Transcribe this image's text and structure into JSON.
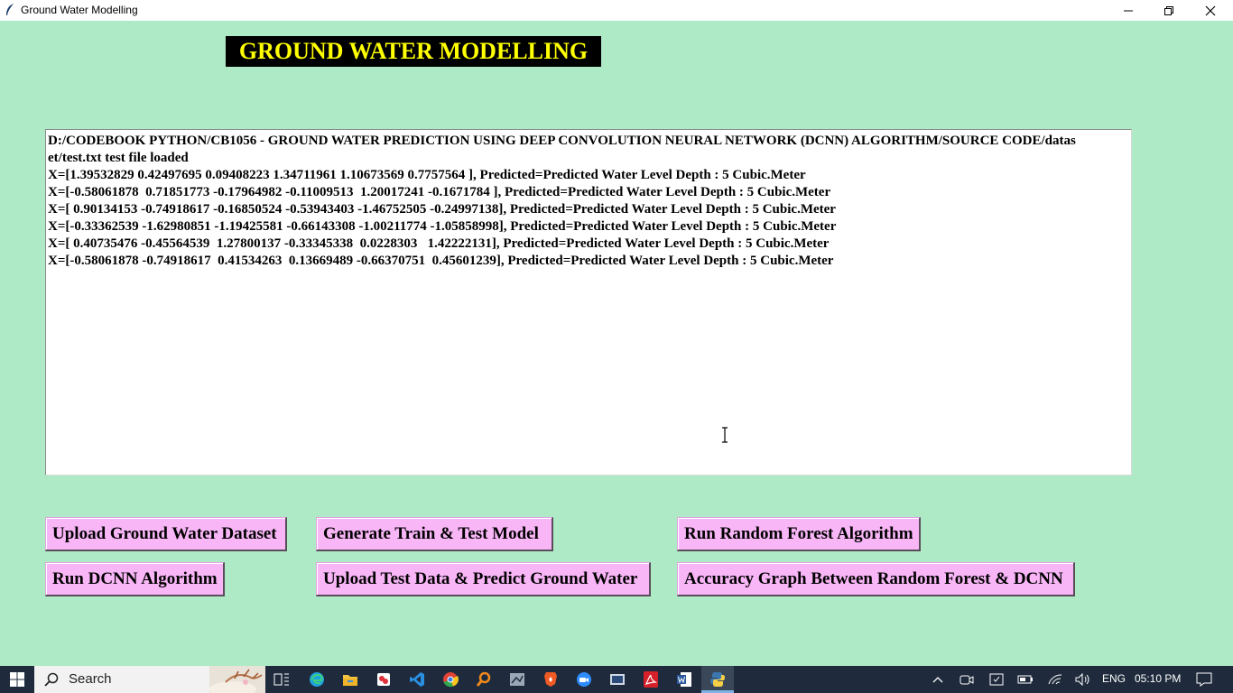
{
  "window": {
    "title": "Ground Water Modelling",
    "controls": [
      "minimize-icon",
      "restore-icon",
      "close-icon"
    ]
  },
  "heading": "GROUND WATER MODELLING",
  "output_lines": [
    "D:/CODEBOOK PYTHON/CB1056 - GROUND WATER PREDICTION USING DEEP CONVOLUTION NEURAL NETWORK (DCNN) ALGORITHM/SOURCE CODE/datas",
    "et/test.txt test file loaded",
    "X=[1.39532829 0.42497695 0.09408223 1.34711961 1.10673569 0.7757564 ], Predicted=Predicted Water Level Depth : 5 Cubic.Meter",
    "X=[-0.58061878  0.71851773 -0.17964982 -0.11009513  1.20017241 -0.1671784 ], Predicted=Predicted Water Level Depth : 5 Cubic.Meter",
    "X=[ 0.90134153 -0.74918617 -0.16850524 -0.53943403 -1.46752505 -0.24997138], Predicted=Predicted Water Level Depth : 5 Cubic.Meter",
    "X=[-0.33362539 -1.62980851 -1.19425581 -0.66143308 -1.00211774 -1.05858998], Predicted=Predicted Water Level Depth : 5 Cubic.Meter",
    "X=[ 0.40735476 -0.45564539  1.27800137 -0.33345338  0.0228303   1.42222131], Predicted=Predicted Water Level Depth : 5 Cubic.Meter",
    "X=[-0.58061878 -0.74918617  0.41534263  0.13669489 -0.66370751  0.45601239], Predicted=Predicted Water Level Depth : 5 Cubic.Meter"
  ],
  "buttons": {
    "upload_dataset": "Upload Ground Water Dataset",
    "generate_model": "Generate Train & Test Model",
    "run_random_forest": "Run Random Forest Algorithm",
    "run_dcnn": "Run DCNN Algorithm",
    "upload_test_predict": "Upload Test Data & Predict Ground Water",
    "accuracy_graph": "Accuracy Graph Between Random Forest & DCNN"
  },
  "taskbar": {
    "search_placeholder": "Search",
    "language": "ENG",
    "time": "05:10 PM",
    "pinned_apps": [
      "task-view-icon",
      "edge-icon",
      "file-explorer-icon",
      "app-icon",
      "vscode-icon",
      "chrome-icon",
      "search-app-icon",
      "app-icon",
      "brave-icon",
      "zoom-icon",
      "sc-app-icon",
      "acrobat-icon",
      "word-icon",
      "python-icon"
    ]
  },
  "colors": {
    "background": "#aeeac6",
    "heading_bg": "#000000",
    "heading_fg": "#ffff00",
    "button_bg": "#f9b6f7",
    "taskbar_bg": "#1f2b3c"
  }
}
